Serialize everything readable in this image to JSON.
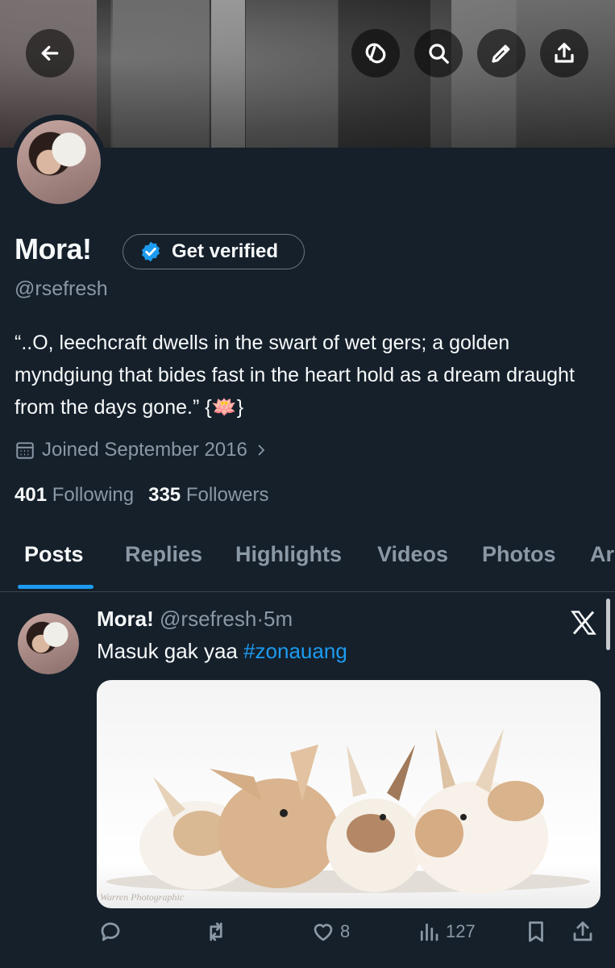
{
  "banner": {
    "back_icon": "arrow-left-icon",
    "sync_icon": "sync-icon",
    "search_icon": "search-icon",
    "edit_icon": "pencil-icon",
    "share_icon": "share-icon"
  },
  "profile": {
    "name": "Mora!",
    "get_verified": "Get verified",
    "handle": "@rsefresh",
    "bio": "“..O, leechcraft dwells in the swart of wet gers; a golden myndgiung that bides fast in the heart hold as a dream draught from the days gone.” {🪷}",
    "joined": "Joined September 2016",
    "following_count": "401",
    "following_label": "Following",
    "followers_count": "335",
    "followers_label": "Followers"
  },
  "tabs": [
    "Posts",
    "Replies",
    "Highlights",
    "Videos",
    "Photos",
    "Ar"
  ],
  "post": {
    "name": "Mora!",
    "handle": "@rsefresh",
    "sep": "·",
    "time": "5m",
    "text": "Masuk gak yaa ",
    "hashtag": "#zonauang",
    "watermark": "Warren Photographic",
    "likes": "8",
    "views": "127"
  },
  "colors": {
    "background": "#15202b",
    "accent": "#1d9bf0",
    "secondary_text": "#8b98a5"
  }
}
